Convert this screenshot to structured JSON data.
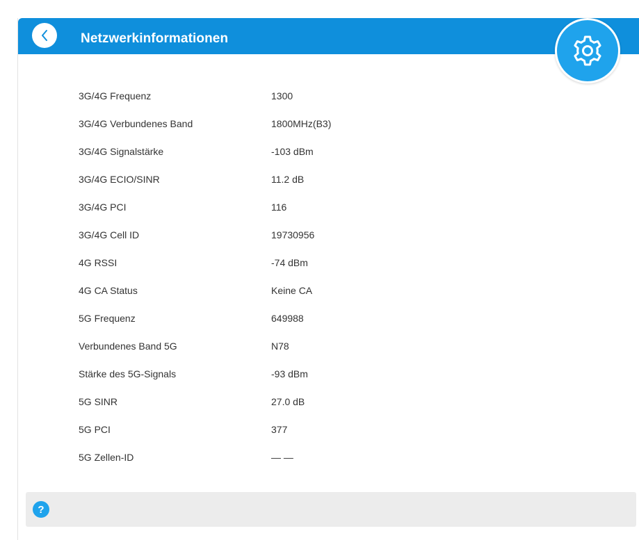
{
  "header": {
    "title": "Netzwerkinformationen",
    "back_icon": "chevron-left-icon",
    "settings_icon": "gear-icon"
  },
  "colors": {
    "header_bg": "#0f8fdc",
    "accent": "#1fa3ec",
    "help_bar_bg": "#ececec",
    "text": "#333333"
  },
  "rows": [
    {
      "label": "3G/4G Frequenz",
      "value": "1300"
    },
    {
      "label": "3G/4G Verbundenes Band",
      "value": "1800MHz(B3)"
    },
    {
      "label": "3G/4G Signalstärke",
      "value": "-103 dBm"
    },
    {
      "label": "3G/4G ECIO/SINR",
      "value": "11.2 dB"
    },
    {
      "label": "3G/4G PCI",
      "value": "116"
    },
    {
      "label": "3G/4G Cell ID",
      "value": "19730956"
    },
    {
      "label": "4G RSSI",
      "value": "-74 dBm"
    },
    {
      "label": "4G CA Status",
      "value": "Keine CA"
    },
    {
      "label": "5G Frequenz",
      "value": "649988"
    },
    {
      "label": "Verbundenes Band 5G",
      "value": "N78"
    },
    {
      "label": "Stärke des 5G-Signals",
      "value": "-93 dBm"
    },
    {
      "label": "5G SINR",
      "value": "27.0 dB"
    },
    {
      "label": "5G PCI",
      "value": "377"
    },
    {
      "label": "5G Zellen-ID",
      "value": "— —"
    }
  ],
  "help": {
    "icon_text": "?",
    "icon": "question-mark-icon"
  }
}
